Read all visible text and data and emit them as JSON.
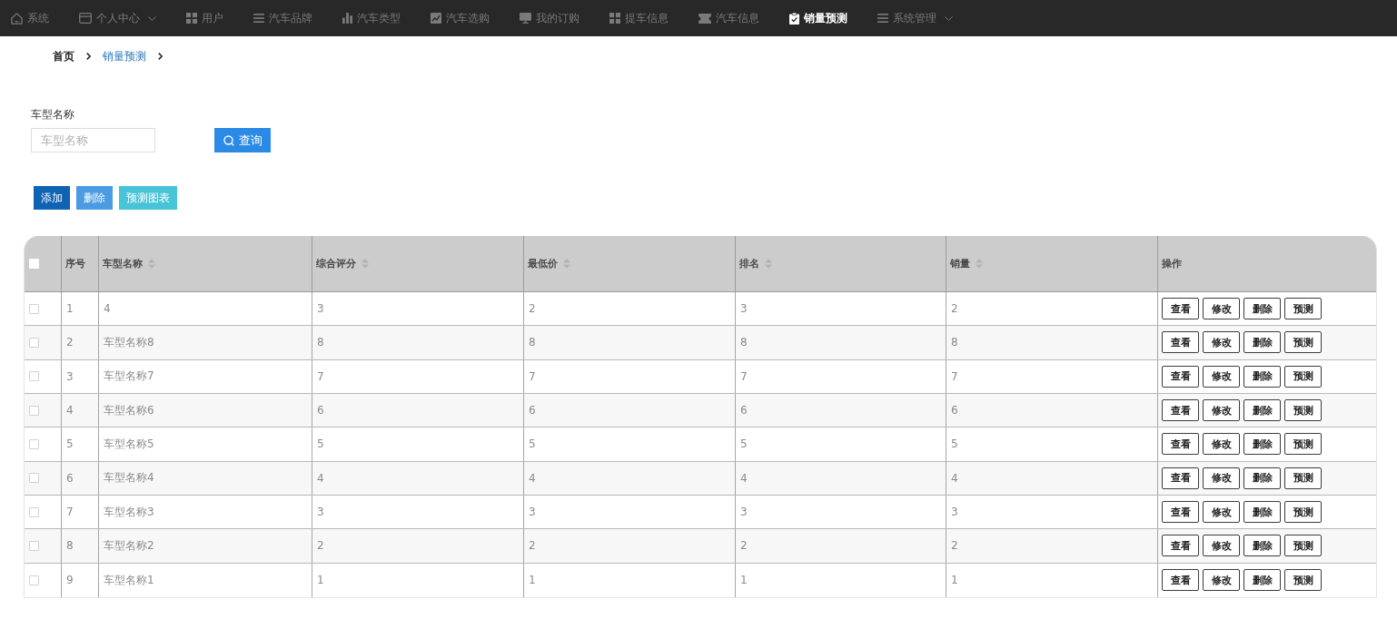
{
  "nav": {
    "items": [
      {
        "label": "系统",
        "selected": false,
        "dropdown": false
      },
      {
        "label": "个人中心",
        "selected": false,
        "dropdown": true
      },
      {
        "label": "用户",
        "selected": false,
        "dropdown": false
      },
      {
        "label": "汽车品牌",
        "selected": false,
        "dropdown": false
      },
      {
        "label": "汽车类型",
        "selected": false,
        "dropdown": false
      },
      {
        "label": "汽车选购",
        "selected": false,
        "dropdown": false
      },
      {
        "label": "我的订购",
        "selected": false,
        "dropdown": false
      },
      {
        "label": "提车信息",
        "selected": false,
        "dropdown": false
      },
      {
        "label": "汽车信息",
        "selected": false,
        "dropdown": false
      },
      {
        "label": "销量预测",
        "selected": true,
        "dropdown": false
      },
      {
        "label": "系统管理",
        "selected": false,
        "dropdown": true
      }
    ]
  },
  "breadcrumb": [
    {
      "label": "首页",
      "selected": false
    },
    {
      "label": "销量预测",
      "selected": true
    }
  ],
  "search": {
    "label": "车型名称",
    "placeholder": "车型名称",
    "button": "查询"
  },
  "toolbar": [
    {
      "label": "添加",
      "kind": "add"
    },
    {
      "label": "删除",
      "kind": "delete"
    },
    {
      "label": "预测图表",
      "kind": "chart"
    }
  ],
  "table": {
    "all_checked": false,
    "columns": [
      {
        "label": "序号",
        "sortable": false
      },
      {
        "label": "车型名称",
        "sortable": true
      },
      {
        "label": "综合评分",
        "sortable": true
      },
      {
        "label": "最低价",
        "sortable": true
      },
      {
        "label": "排名",
        "sortable": true
      },
      {
        "label": "销量",
        "sortable": true
      },
      {
        "label": "操作",
        "sortable": false
      }
    ],
    "rows": [
      {
        "checked": false,
        "cells": [
          "1",
          "4",
          "3",
          "2",
          "3",
          "2"
        ],
        "actions": [
          "查看",
          "修改",
          "删除",
          "预测"
        ]
      },
      {
        "checked": false,
        "cells": [
          "2",
          "车型名称8",
          "8",
          "8",
          "8",
          "8"
        ],
        "actions": [
          "查看",
          "修改",
          "删除",
          "预测"
        ]
      },
      {
        "checked": false,
        "cells": [
          "3",
          "车型名称7",
          "7",
          "7",
          "7",
          "7"
        ],
        "actions": [
          "查看",
          "修改",
          "删除",
          "预测"
        ]
      },
      {
        "checked": false,
        "cells": [
          "4",
          "车型名称6",
          "6",
          "6",
          "6",
          "6"
        ],
        "actions": [
          "查看",
          "修改",
          "删除",
          "预测"
        ]
      },
      {
        "checked": false,
        "cells": [
          "5",
          "车型名称5",
          "5",
          "5",
          "5",
          "5"
        ],
        "actions": [
          "查看",
          "修改",
          "删除",
          "预测"
        ]
      },
      {
        "checked": false,
        "cells": [
          "6",
          "车型名称4",
          "4",
          "4",
          "4",
          "4"
        ],
        "actions": [
          "查看",
          "修改",
          "删除",
          "预测"
        ]
      },
      {
        "checked": false,
        "cells": [
          "7",
          "车型名称3",
          "3",
          "3",
          "3",
          "3"
        ],
        "actions": [
          "查看",
          "修改",
          "删除",
          "预测"
        ]
      },
      {
        "checked": false,
        "cells": [
          "8",
          "车型名称2",
          "2",
          "2",
          "2",
          "2"
        ],
        "actions": [
          "查看",
          "修改",
          "删除",
          "预测"
        ]
      },
      {
        "checked": false,
        "cells": [
          "9",
          "车型名称1",
          "1",
          "1",
          "1",
          "1"
        ],
        "actions": [
          "查看",
          "修改",
          "删除",
          "预测"
        ]
      }
    ]
  }
}
